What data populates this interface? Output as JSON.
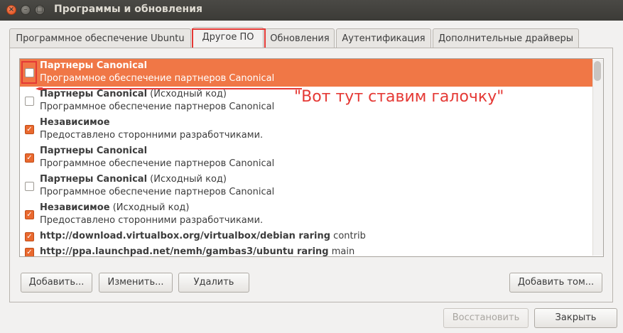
{
  "window": {
    "title": "Программы и обновления",
    "close_glyph": "×",
    "min_glyph": "–",
    "max_glyph": "□"
  },
  "tabs": [
    {
      "label": "Программное обеспечение Ubuntu"
    },
    {
      "label": "Другое ПО"
    },
    {
      "label": "Обновления"
    },
    {
      "label": "Аутентификация"
    },
    {
      "label": "Дополнительные драйверы"
    }
  ],
  "annotation": "\"Вот тут ставим галочку\"",
  "sources": [
    {
      "title": "Партнеры Canonical",
      "suffix": "",
      "desc": "Программное обеспечение партнеров Canonical",
      "checked": false,
      "selected": true
    },
    {
      "title": "Партнеры Canonical",
      "suffix": " (Исходный код)",
      "desc": "Программное обеспечение партнеров Canonical",
      "checked": false,
      "selected": false
    },
    {
      "title": "Независимое",
      "suffix": "",
      "desc": "Предоставлено сторонними разработчиками.",
      "checked": true,
      "selected": false
    },
    {
      "title": "Партнеры Canonical",
      "suffix": "",
      "desc": "Программное обеспечение партнеров Canonical",
      "checked": true,
      "selected": false
    },
    {
      "title": "Партнеры Canonical",
      "suffix": " (Исходный код)",
      "desc": "Программное обеспечение партнеров Canonical",
      "checked": false,
      "selected": false
    },
    {
      "title": "Независимое",
      "suffix": " (Исходный код)",
      "desc": "Предоставлено сторонними разработчиками.",
      "checked": true,
      "selected": false
    },
    {
      "title": "http://download.virtualbox.org/virtualbox/debian raring",
      "suffix": " contrib",
      "desc": "",
      "checked": true,
      "selected": false
    },
    {
      "title": "http://ppa.launchpad.net/nemh/gambas3/ubuntu raring",
      "suffix": " main",
      "desc": "",
      "checked": true,
      "selected": false
    }
  ],
  "buttons": {
    "add": "Добавить...",
    "edit": "Изменить...",
    "remove": "Удалить",
    "add_volume": "Добавить том...",
    "revert": "Восстановить",
    "close": "Закрыть"
  },
  "colors": {
    "selection": "#f07746",
    "checkbox_on": "#e9692f",
    "annotation": "#e53935"
  },
  "icons": {
    "check": "✓"
  }
}
